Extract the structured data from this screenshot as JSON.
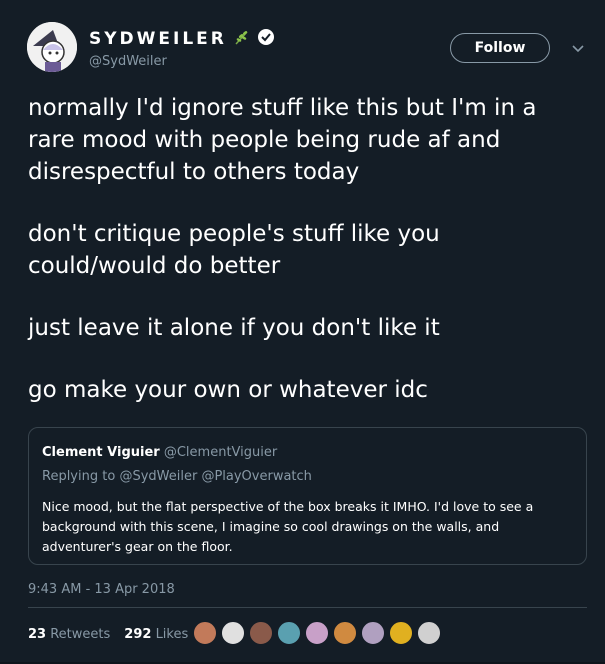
{
  "author": {
    "display_name": "SYDWEILER",
    "handle": "@SydWeiler",
    "verified": true,
    "name_emoji": "herb-icon"
  },
  "actions": {
    "follow_label": "Follow",
    "menu_icon": "chevron-down-icon"
  },
  "tweet": {
    "paragraphs": [
      "normally I'd ignore stuff like this but I'm in a rare mood with people being rude af and disrespectful to others today",
      "don't critique people's stuff like you could/would do better",
      "just leave it alone if you don't like it",
      "go make your own or whatever idc"
    ],
    "timestamp": "9:43 AM - 13 Apr 2018"
  },
  "quoted_tweet": {
    "name": "Clement Viguier",
    "handle": "@ClementViguier",
    "replying_prefix": "Replying to",
    "replying_to_1": "@SydWeiler",
    "replying_to_2": "@PlayOverwatch",
    "text": "Nice mood, but the flat perspective of the box breaks it IMHO. I'd love to see a background with this scene, I imagine so cool drawings on the walls, and adventurer's gear on the floor."
  },
  "stats": {
    "retweets_count": "23",
    "retweets_label": "Retweets",
    "likes_count": "292",
    "likes_label": "Likes"
  },
  "liker_avatars": [
    "#c27a5a",
    "#e0e0e0",
    "#8a5a4a",
    "#5aa0b0",
    "#c8a0c8",
    "#d08a40",
    "#b0a0c0",
    "#e0b020",
    "#d0d0d0"
  ],
  "colors": {
    "background": "#141d26",
    "secondary_text": "#8899a6",
    "border": "#38444d"
  }
}
